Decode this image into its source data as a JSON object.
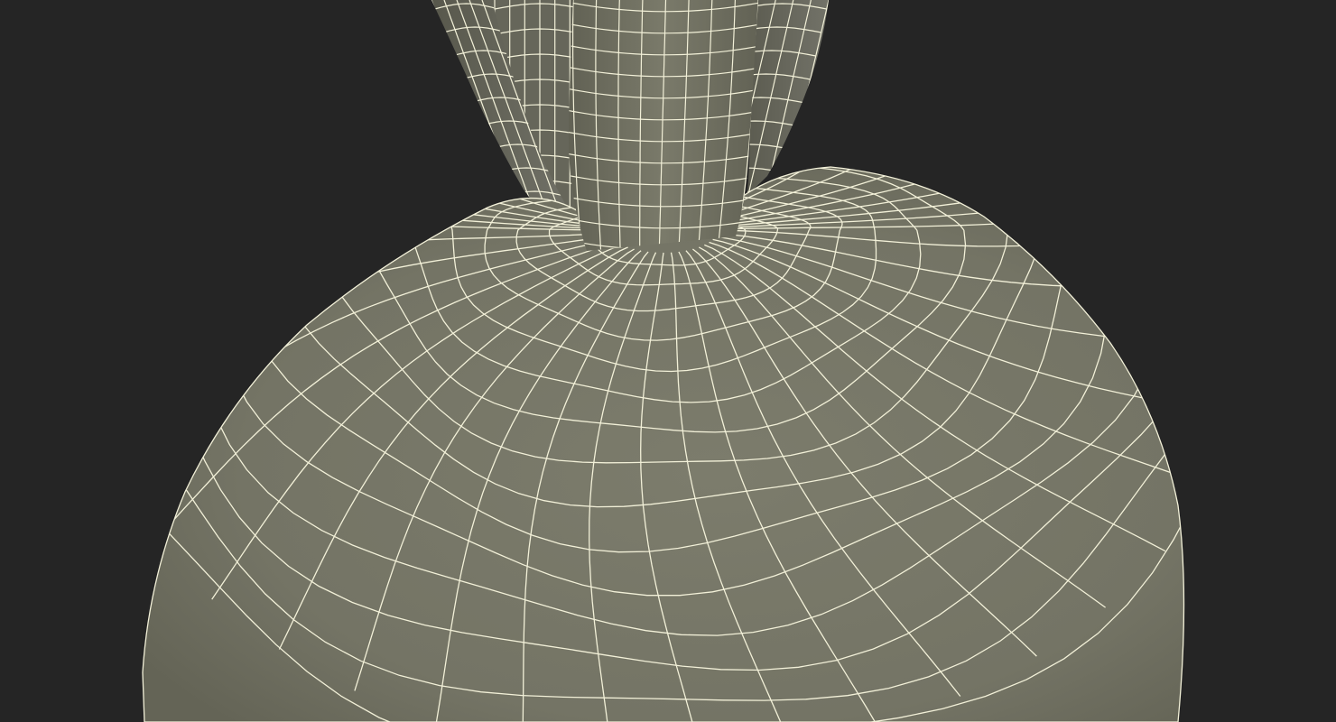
{
  "viewport": {
    "background_color": "#252525",
    "surface_color": "#787868",
    "wire_color": "#f2f0d8"
  },
  "model": {
    "shape": "wireframe-bulb-with-twisted-stem",
    "display_mode": "shaded-wireframe"
  }
}
